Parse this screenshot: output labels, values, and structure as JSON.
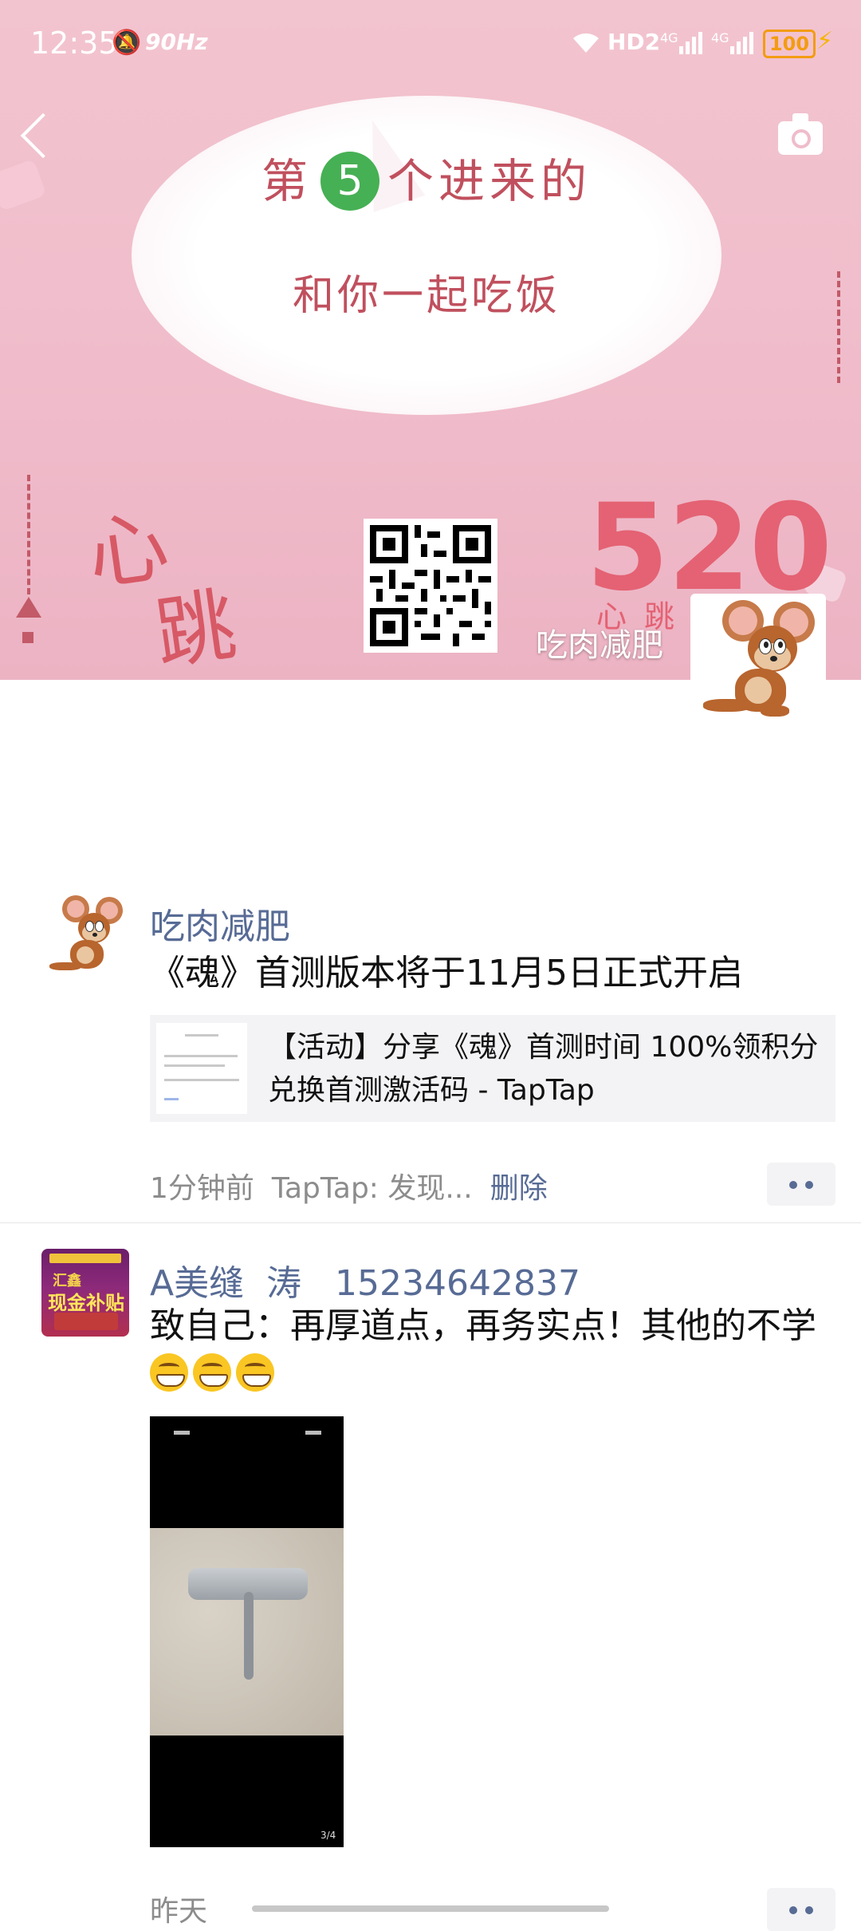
{
  "status_bar": {
    "time": "12:35",
    "refresh_rate": "90Hz",
    "network_hd": "HD2",
    "sim1": "4G",
    "sim2": "4G",
    "battery": "100"
  },
  "cover": {
    "bubble_line1_prefix": "第",
    "bubble_number": "5",
    "bubble_line1_suffix": "个进来的",
    "bubble_line2": "和你一起吃饭",
    "heart_text_1": "心",
    "heart_text_2": "跳",
    "big_number": "520",
    "heart_subtitle": "心跳实",
    "user_name": "吃肉减肥"
  },
  "posts": [
    {
      "nickname": "吃肉减肥",
      "text": "《魂》首测版本将于11月5日正式开启",
      "share_title": "【活动】分享《魂》首测时间 100%领积分兑换首测激活码 - TapTap",
      "time": "1分钟前",
      "source": "TapTap: 发现...",
      "delete_label": "删除"
    },
    {
      "nickname": "A美缝  涛   15234642837",
      "text": "致自己：再厚道点，再务实点！其他的不学",
      "emoji_count": 3,
      "photo_index": "3/4",
      "time": "昨天"
    }
  ],
  "icons": {
    "back": "back-arrow-icon",
    "camera": "camera-icon",
    "more": "more-dots-icon",
    "emoji": "grinning-emoji-icon"
  },
  "colors": {
    "link_blue": "#576b95",
    "cover_pink": "#f0bccb",
    "accent_red": "#e46273",
    "green_circle": "#46b054"
  }
}
